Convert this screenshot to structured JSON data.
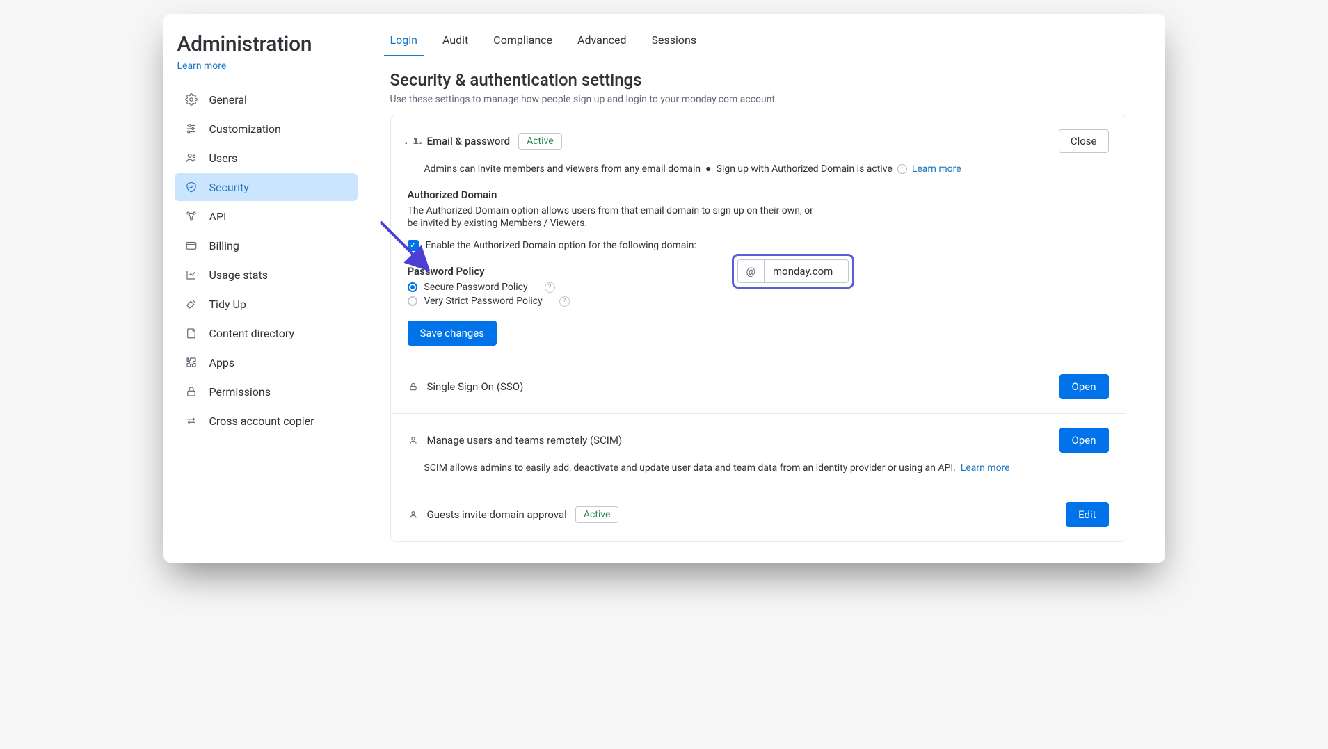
{
  "sidebar": {
    "title": "Administration",
    "learn_more": "Learn more",
    "items": [
      {
        "label": "General"
      },
      {
        "label": "Customization"
      },
      {
        "label": "Users"
      },
      {
        "label": "Security"
      },
      {
        "label": "API"
      },
      {
        "label": "Billing"
      },
      {
        "label": "Usage stats"
      },
      {
        "label": "Tidy Up"
      },
      {
        "label": "Content directory"
      },
      {
        "label": "Apps"
      },
      {
        "label": "Permissions"
      },
      {
        "label": "Cross account copier"
      }
    ]
  },
  "tabs": [
    "Login",
    "Audit",
    "Compliance",
    "Advanced",
    "Sessions"
  ],
  "page": {
    "title": "Security & authentication settings",
    "subtitle": "Use these settings to manage how people sign up and login to your monday.com account."
  },
  "email_pw": {
    "title": "Email & password",
    "badge": "Active",
    "close": "Close",
    "desc_a": "Admins can invite members and viewers from any email domain",
    "desc_b": "Sign up with Authorized Domain is active",
    "learn": "Learn more",
    "auth_head": "Authorized Domain",
    "auth_text_1": "The Authorized Domain option allows users from that email domain to sign up on their own, or",
    "auth_text_2": "be invited by existing Members / Viewers.",
    "chk_label": "Enable the Authorized Domain option for the following domain:",
    "at": "@",
    "domain_value": "monday.com",
    "pw_head": "Password Policy",
    "pw_opt_1": "Secure Password Policy",
    "pw_opt_2": "Very Strict Password Policy",
    "save": "Save changes"
  },
  "sso": {
    "title": "Single Sign-On (SSO)",
    "btn": "Open"
  },
  "scim": {
    "title": "Manage users and teams remotely (SCIM)",
    "btn": "Open",
    "desc": "SCIM allows admins to easily add, deactivate and update user data and team data from an identity provider or using an API.",
    "learn": "Learn more"
  },
  "guests": {
    "title": "Guests invite domain approval",
    "badge": "Active",
    "btn": "Edit"
  }
}
